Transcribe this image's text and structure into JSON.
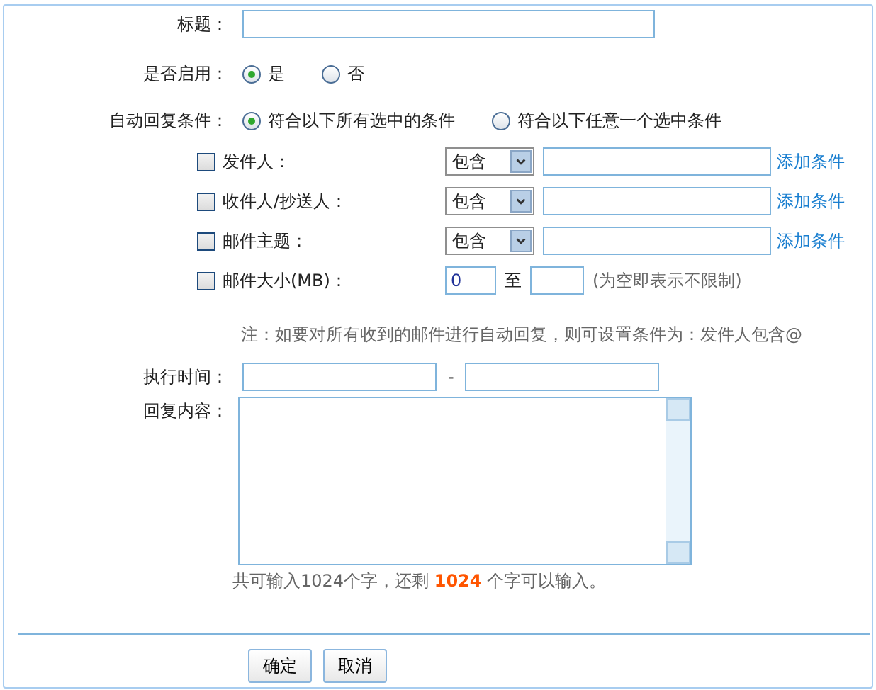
{
  "title_row": {
    "label": "标题："
  },
  "enable_row": {
    "label": "是否启用：",
    "options": [
      {
        "label": "是",
        "selected": true
      },
      {
        "label": "否",
        "selected": false
      }
    ]
  },
  "condition_row": {
    "label": "自动回复条件：",
    "options": [
      {
        "label": "符合以下所有选中的条件",
        "selected": true
      },
      {
        "label": "符合以下任意一个选中条件",
        "selected": false
      }
    ]
  },
  "rules": [
    {
      "kind": "match",
      "label": "发件人：",
      "checked": false,
      "operator": "包含",
      "link": "添加条件"
    },
    {
      "kind": "match",
      "label": "收件人/抄送人：",
      "checked": false,
      "operator": "包含",
      "link": "添加条件"
    },
    {
      "kind": "match",
      "label": "邮件主题：",
      "checked": false,
      "operator": "包含",
      "link": "添加条件"
    },
    {
      "kind": "range",
      "label": "邮件大小(MB)：",
      "checked": false,
      "from": "0",
      "separator": "至",
      "hint": "(为空即表示不限制)"
    }
  ],
  "note": "注：如要对所有收到的邮件进行自动回复，则可设置条件为：发件人包含@",
  "time_row": {
    "label": "执行时间：",
    "separator": "-"
  },
  "reply_row": {
    "label": "回复内容：",
    "counter": "共可输入1024个字，还剩 **1024** 个字可以输入。"
  },
  "buttons": [
    "确定",
    "取消"
  ]
}
